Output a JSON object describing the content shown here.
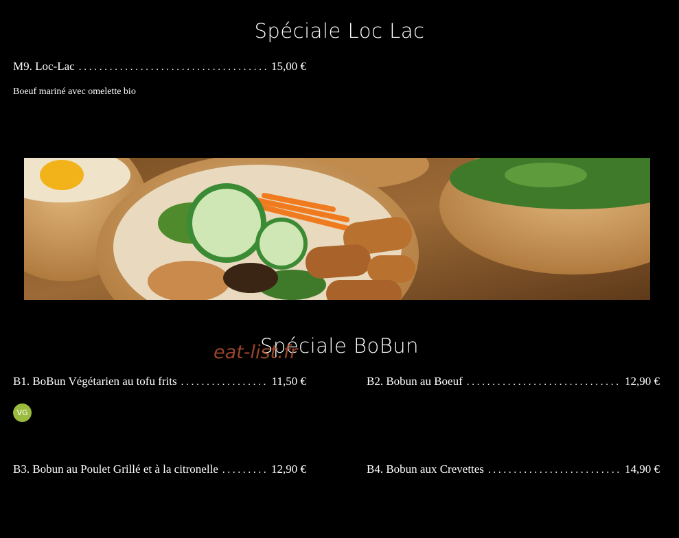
{
  "loclac": {
    "title": "Spéciale Loc Lac",
    "items": [
      {
        "name": "M9. Loc-Lac",
        "price": "15,00 €",
        "description": "Boeuf mariné avec omelette bio"
      }
    ]
  },
  "bobun": {
    "title": "Spéciale BoBun",
    "items": [
      {
        "name": "B1. BoBun Végétarien au tofu frits",
        "price": "11,50 €",
        "badge": "VG"
      },
      {
        "name": "B2. Bobun au Boeuf",
        "price": "12,90 €"
      },
      {
        "name": "B3. Bobun au Poulet Grillé et à la citronelle",
        "price": "12,90 €"
      },
      {
        "name": "B4. Bobun aux Crevettes",
        "price": "14,90 €"
      }
    ]
  },
  "watermark": "eat-list.fr",
  "colors": {
    "background": "#000000",
    "text": "#ffffff",
    "badge": "#9bbb3f",
    "watermark": "#b5522f"
  }
}
